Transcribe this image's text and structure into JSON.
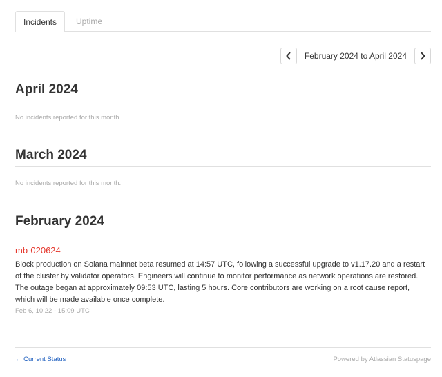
{
  "tabs": [
    {
      "label": "Incidents",
      "active": true
    },
    {
      "label": "Uptime",
      "active": false
    }
  ],
  "pager": {
    "range_label": "February 2024 to April 2024",
    "prev_icon": "chevron-left-icon",
    "next_icon": "chevron-right-icon"
  },
  "months": [
    {
      "title": "April 2024",
      "empty_text": "No incidents reported for this month."
    },
    {
      "title": "March 2024",
      "empty_text": "No incidents reported for this month."
    },
    {
      "title": "February 2024",
      "incident": {
        "title": "mb-020624",
        "body": "Block production on Solana mainnet beta resumed at 14:57 UTC, following a successful upgrade to v1.17.20 and a restart of the cluster by validator operators. Engineers will continue to monitor performance as network operations are restored. The outage began at approximately 09:53 UTC, lasting 5 hours. Core contributors are working on a root cause report, which will be made available once complete.",
        "date": "Feb 6, 10:22 - 15:09 UTC"
      }
    }
  ],
  "footer": {
    "back_link": "← Current Status",
    "powered_by": "Powered by Atlassian Statuspage"
  },
  "colors": {
    "incident_title": "#e5372c",
    "link": "#1f5fbf",
    "muted": "#aaaaaa"
  }
}
